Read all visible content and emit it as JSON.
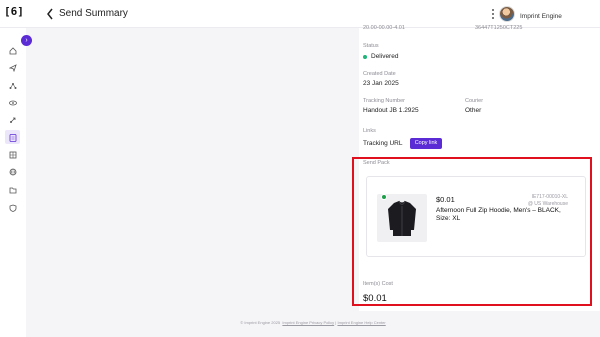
{
  "app": {
    "logo_text": "[6]"
  },
  "header": {
    "title": "Send Summary",
    "account_name": "Imprint Engine",
    "top_right_partial": "36447T1250CT225"
  },
  "details": {
    "top_partial_date": "20.00-00.00-4.01",
    "status_label": "Status",
    "status_value": "Delivered",
    "status_color": "#20b37a",
    "created_label": "Created Date",
    "created_value": "23 Jan 2025",
    "tracking_label": "Tracking Number",
    "tracking_value": "Handout JB 1.2925",
    "courier_label": "Courier",
    "courier_value": "Other",
    "links_label": "Links",
    "tracking_url_label": "Tracking URL",
    "copy_link_label": "Copy link"
  },
  "send_pack": {
    "label": "Send Pack",
    "item": {
      "price": "$0.01",
      "sku": "IE717-00010-XL",
      "warehouse": "@ US Warehouse",
      "name": "Afternoon Full Zip Hoodie, Men's – BLACK, Size: XL"
    },
    "cost_label": "Item(s) Cost",
    "cost_value": "$0.01"
  },
  "footer": {
    "copyright": "© Imprint Engine 2025",
    "privacy_link": "Imprint Engine Privacy Policy",
    "separator": "|",
    "help_link": "Imprint Engine Help Center"
  },
  "colors": {
    "accent": "#5b2bd6",
    "highlight": "#e0101e"
  }
}
